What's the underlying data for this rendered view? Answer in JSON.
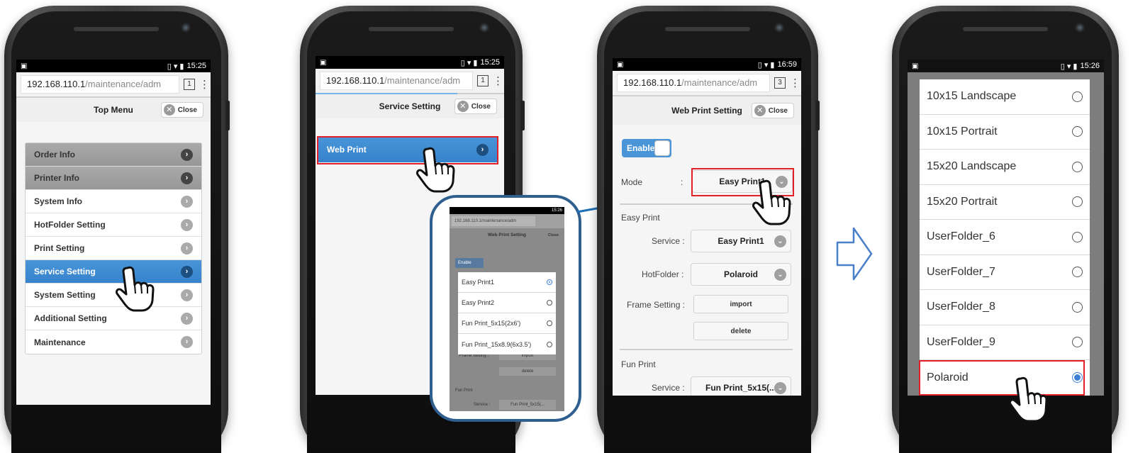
{
  "common": {
    "status_left_icon": "▣",
    "status_icons": "▯ ▾ ▮",
    "url_host": "192.168.110.1",
    "url_path": "/maintenance/adm",
    "kebab": "⋮",
    "close_label": "Close",
    "chevron": "›",
    "dropdown": "⌄"
  },
  "phone1": {
    "time": "15:25",
    "tabs": "1",
    "header_title": "Top Menu",
    "menu": [
      {
        "label": "Order Info",
        "state": "gray"
      },
      {
        "label": "Printer Info",
        "state": "gray"
      },
      {
        "label": "System Info",
        "state": "normal"
      },
      {
        "label": "HotFolder Setting",
        "state": "normal"
      },
      {
        "label": "Print Setting",
        "state": "normal"
      },
      {
        "label": "Service Setting",
        "state": "active"
      },
      {
        "label": "System Setting",
        "state": "normal"
      },
      {
        "label": "Additional Setting",
        "state": "normal"
      },
      {
        "label": "Maintenance",
        "state": "normal"
      }
    ]
  },
  "phone2": {
    "time": "15:25",
    "tabs": "1",
    "header_title": "Service Setting",
    "web_print_label": "Web Print",
    "inset": {
      "time": "15:26",
      "url": "192.168.110.1/maintenance/adm",
      "header_title": "Web Print Setting",
      "close_label": "Close",
      "enable_label": "Enable",
      "options": [
        {
          "label": "Easy Print1",
          "selected": true
        },
        {
          "label": "Easy Print2",
          "selected": false
        },
        {
          "label": "Fun Print_5x15(2x6')",
          "selected": false
        },
        {
          "label": "Fun Print_15x8.9(6x3.5')",
          "selected": false
        }
      ],
      "frame_setting_label": "Frame Setting :",
      "import_label": "import",
      "delete_label": "delete",
      "fun_print_label": "Fun Print",
      "service_label": "Service :",
      "service_value": "Fun Print_5x15(..."
    }
  },
  "phone3": {
    "time": "16:59",
    "tabs": "3",
    "header_title": "Web Print Setting",
    "enable_label": "Enable",
    "mode_label": "Mode",
    "mode_colon": ":",
    "mode_value": "Easy Print1",
    "easy_print_title": "Easy Print",
    "service_label": "Service :",
    "service_value": "Easy Print1",
    "hotfolder_label": "HotFolder :",
    "hotfolder_value": "Polaroid",
    "frame_setting_label": "Frame Setting :",
    "import_label": "import",
    "delete_label": "delete",
    "fun_print_title": "Fun Print",
    "fun_service_label": "Service :",
    "fun_service_value": "Fun Print_5x15(..."
  },
  "phone4": {
    "time": "15:26",
    "options": [
      {
        "label": "10x15 Landscape",
        "selected": false
      },
      {
        "label": "10x15 Portrait",
        "selected": false
      },
      {
        "label": "15x20 Landscape",
        "selected": false
      },
      {
        "label": "15x20 Portrait",
        "selected": false
      },
      {
        "label": "UserFolder_6",
        "selected": false
      },
      {
        "label": "UserFolder_7",
        "selected": false
      },
      {
        "label": "UserFolder_8",
        "selected": false
      },
      {
        "label": "UserFolder_9",
        "selected": false
      },
      {
        "label": "Polaroid",
        "selected": true
      }
    ]
  },
  "colors": {
    "accent_blue": "#3583cc",
    "highlight_red": "#e2202a",
    "inset_frame": "#2f5f8f",
    "arrow_blue": "#1c6fb8"
  }
}
